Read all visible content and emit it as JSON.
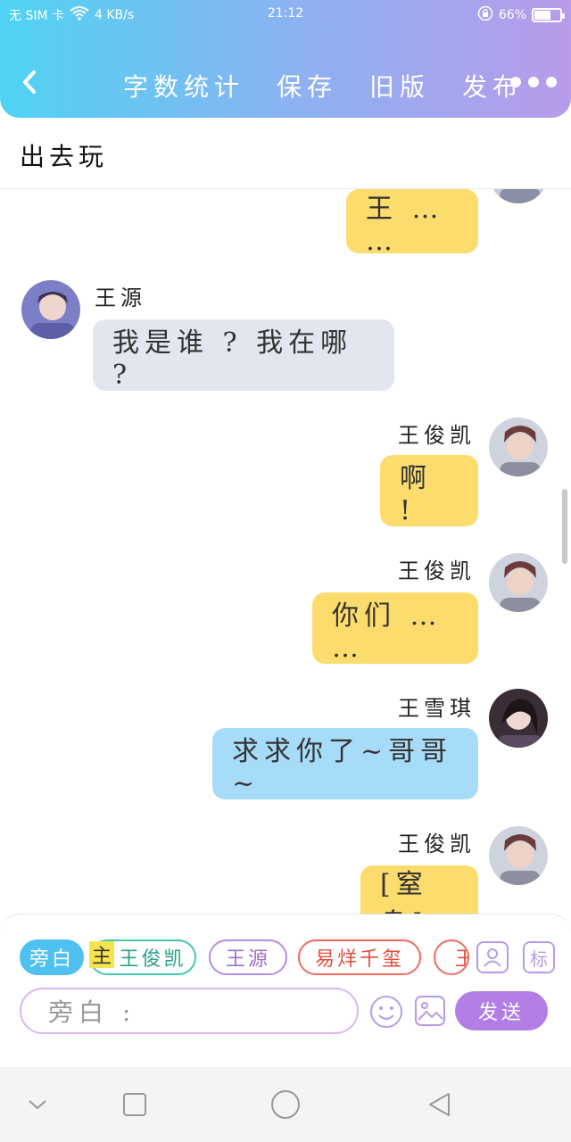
{
  "status": {
    "carrier": "无 SIM 卡",
    "net_speed": "4 KB/s",
    "time": "21:12",
    "battery_text": "66%",
    "battery_level": 0.66
  },
  "toolbar": {
    "actions": [
      "字数统计",
      "保存",
      "旧版",
      "发布"
    ]
  },
  "story_title": "出去玩",
  "messages": [
    {
      "side": "right",
      "name": "",
      "text": "王 … …",
      "color": "yellow"
    },
    {
      "side": "left",
      "name": "王源",
      "text": "我是谁 ? 我在哪 ?",
      "color": "gray"
    },
    {
      "side": "right",
      "name": "王俊凯",
      "text": "啊 !",
      "color": "yellow"
    },
    {
      "side": "right",
      "name": "王俊凯",
      "text": "你们 … …",
      "color": "yellow"
    },
    {
      "side": "right",
      "name": "王雪琪",
      "text": "求求你了~哥哥~",
      "color": "blue"
    },
    {
      "side": "right",
      "name": "王俊凯",
      "text": "[窒息]",
      "color": "yellow"
    }
  ],
  "roles": {
    "narrator": "旁白",
    "main_tag": "主",
    "chips": [
      "王俊凯",
      "王源",
      "易烊千玺",
      "王"
    ]
  },
  "tools": {
    "tag_label": "标"
  },
  "input": {
    "placeholder": "旁白 :"
  },
  "send_label": "发送",
  "colors": {
    "header_start": "#4fd3f2",
    "header_end": "#b89bea",
    "yellow_bubble": "#fddc6e",
    "gray_bubble": "#e3e6ee",
    "blue_bubble": "#a6dcf7",
    "send_button": "#b27ee6"
  }
}
